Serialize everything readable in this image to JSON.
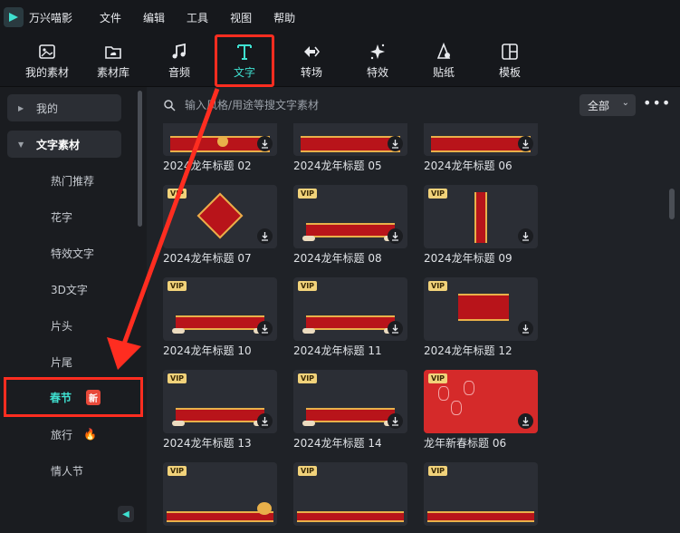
{
  "app": {
    "name": "万兴喵影"
  },
  "menu": [
    "文件",
    "编辑",
    "工具",
    "视图",
    "帮助"
  ],
  "toolbar": {
    "tools": [
      {
        "label": "我的素材",
        "icon": "image-icon"
      },
      {
        "label": "素材库",
        "icon": "cloud-folder-icon"
      },
      {
        "label": "音频",
        "icon": "music-icon"
      },
      {
        "label": "文字",
        "icon": "text-icon",
        "active": true
      },
      {
        "label": "转场",
        "icon": "transition-icon"
      },
      {
        "label": "特效",
        "icon": "effects-icon"
      },
      {
        "label": "贴纸",
        "icon": "sticker-icon"
      },
      {
        "label": "模板",
        "icon": "template-icon"
      }
    ]
  },
  "sidebar": {
    "groups": [
      "我的",
      "文字素材"
    ],
    "items": [
      "热门推荐",
      "花字",
      "特效文字",
      "3D文字",
      "片头",
      "片尾",
      "春节",
      "旅行",
      "情人节"
    ],
    "selected_item": "春节",
    "new_badge": "新"
  },
  "search": {
    "placeholder": "输入风格/用途等搜文字素材",
    "filter_value": "全部"
  },
  "cards": [
    {
      "title": "2024龙年标题 02",
      "vip": false
    },
    {
      "title": "2024龙年标题 05",
      "vip": false
    },
    {
      "title": "2024龙年标题 06",
      "vip": false
    },
    {
      "title": "2024龙年标题 07",
      "vip": true
    },
    {
      "title": "2024龙年标题 08",
      "vip": true
    },
    {
      "title": "2024龙年标题 09",
      "vip": true
    },
    {
      "title": "2024龙年标题 10",
      "vip": true
    },
    {
      "title": "2024龙年标题 11",
      "vip": true
    },
    {
      "title": "2024龙年标题 12",
      "vip": true
    },
    {
      "title": "2024龙年标题 13",
      "vip": true
    },
    {
      "title": "2024龙年标题 14",
      "vip": true
    },
    {
      "title": "龙年新春标题 06",
      "vip": true
    },
    {
      "title": "",
      "vip": true
    },
    {
      "title": "",
      "vip": true
    },
    {
      "title": "",
      "vip": true
    }
  ],
  "vip_label": "VIP",
  "colors": {
    "accent": "#3fe0d0",
    "highlight": "#ff2d20",
    "vip": "#f1d27a",
    "festive_red": "#b8141a"
  }
}
